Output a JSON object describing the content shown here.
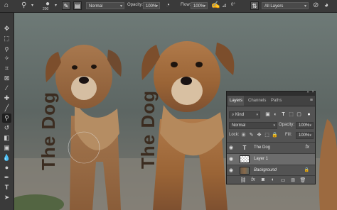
{
  "options_bar": {
    "brush_size": "200",
    "mode": "Normal",
    "opacity_label": "Opacity:",
    "opacity_value": "100%",
    "flow_label": "Flow:",
    "flow_value": "100%",
    "angle_value": "0°",
    "sample": "All Layers"
  },
  "tools": [
    "move-icon",
    "marquee-icon",
    "lasso-icon",
    "quick-select-icon",
    "crop-icon",
    "frame-icon",
    "eyedropper-icon",
    "healing-icon",
    "brush-icon",
    "clone-stamp-icon",
    "history-brush-icon",
    "eraser-icon",
    "gradient-icon",
    "blur-icon",
    "dodge-icon",
    "pen-icon",
    "type-icon",
    "path-select-icon"
  ],
  "canvas": {
    "text_left": "The Dog",
    "text_right": "The Dog"
  },
  "layers_panel": {
    "tabs": [
      "Layers",
      "Channels",
      "Paths"
    ],
    "filter_kind": "Kind",
    "blend_mode": "Normal",
    "opacity_label": "Opacity:",
    "opacity_value": "100%",
    "lock_label": "Lock:",
    "fill_label": "Fill:",
    "fill_value": "100%",
    "layers": [
      {
        "name": "The Dog",
        "type": "text",
        "end": "fx"
      },
      {
        "name": "Layer 1",
        "type": "pixel",
        "selected": true
      },
      {
        "name": "Background",
        "type": "background",
        "end": "lock"
      }
    ]
  }
}
